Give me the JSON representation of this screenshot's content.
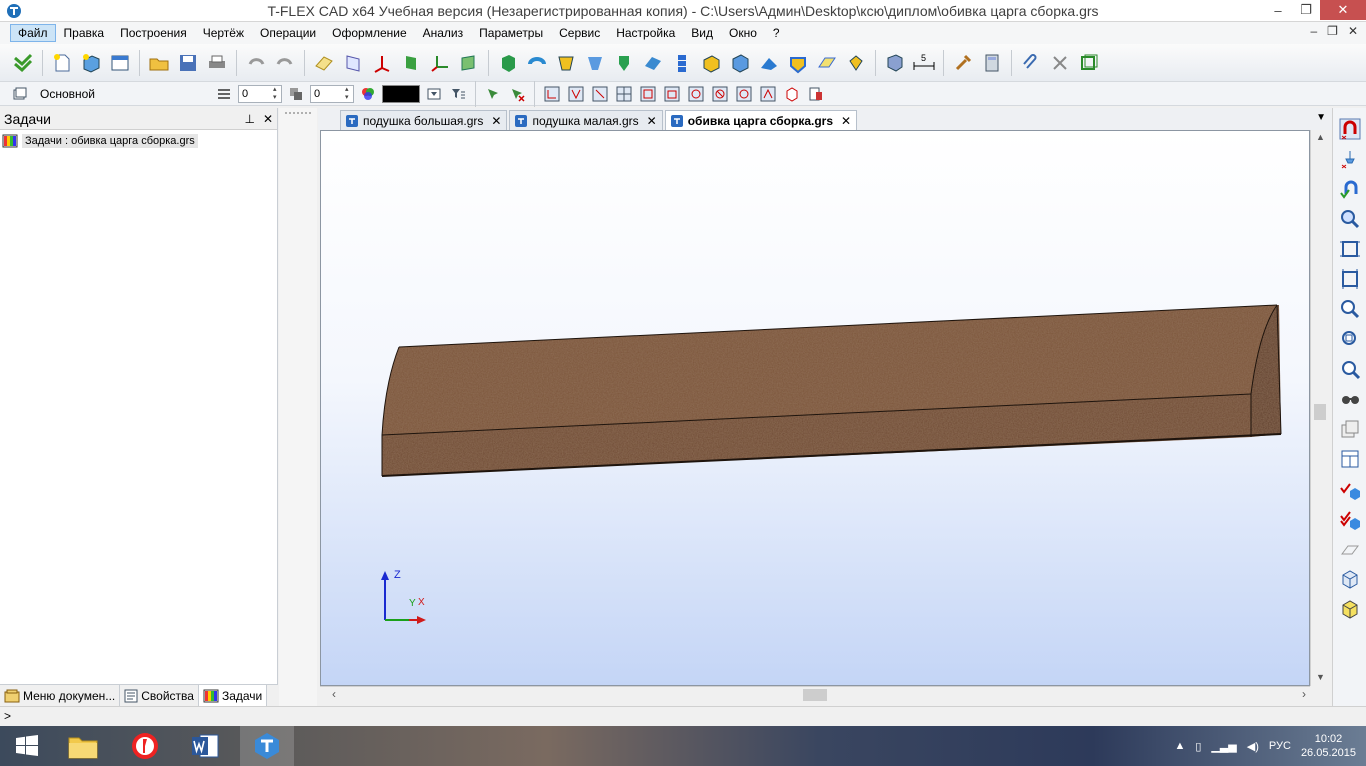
{
  "window": {
    "title": "T-FLEX CAD x64 Учебная версия (Незарегистрированная копия) - C:\\Users\\Админ\\Desktop\\ксю\\диплом\\обивка царга сборка.grs"
  },
  "menu": {
    "items": [
      "Файл",
      "Правка",
      "Построения",
      "Чертёж",
      "Операции",
      "Оформление",
      "Анализ",
      "Параметры",
      "Сервис",
      "Настройка",
      "Вид",
      "Окно",
      "?"
    ],
    "active_index": 0
  },
  "toolbar2": {
    "layer": "Основной",
    "spin1_value": "0",
    "spin2_value": "0",
    "color": "#000000"
  },
  "left_panel": {
    "title": "Задачи",
    "task_label": "Задачи : обивка царга сборка.grs",
    "tabs": [
      "Меню докумен...",
      "Свойства",
      "Задачи"
    ],
    "active_tab_index": 2
  },
  "doc_tabs": [
    {
      "label": "подушка большая.grs",
      "active": false
    },
    {
      "label": "подушка малая.grs",
      "active": false
    },
    {
      "label": "обивка царга сборка.grs",
      "active": true
    }
  ],
  "axes": {
    "z_label": "Z",
    "y_label": "Y",
    "x_label": "X"
  },
  "status": {
    "prompt": ">"
  },
  "taskbar": {
    "language": "РУС",
    "time": "10:02",
    "date": "26.05.2015"
  },
  "colors": {
    "accent": "#0078d7",
    "model_brown": "#7a5238",
    "viewport_bottom": "#c4d5f6"
  }
}
